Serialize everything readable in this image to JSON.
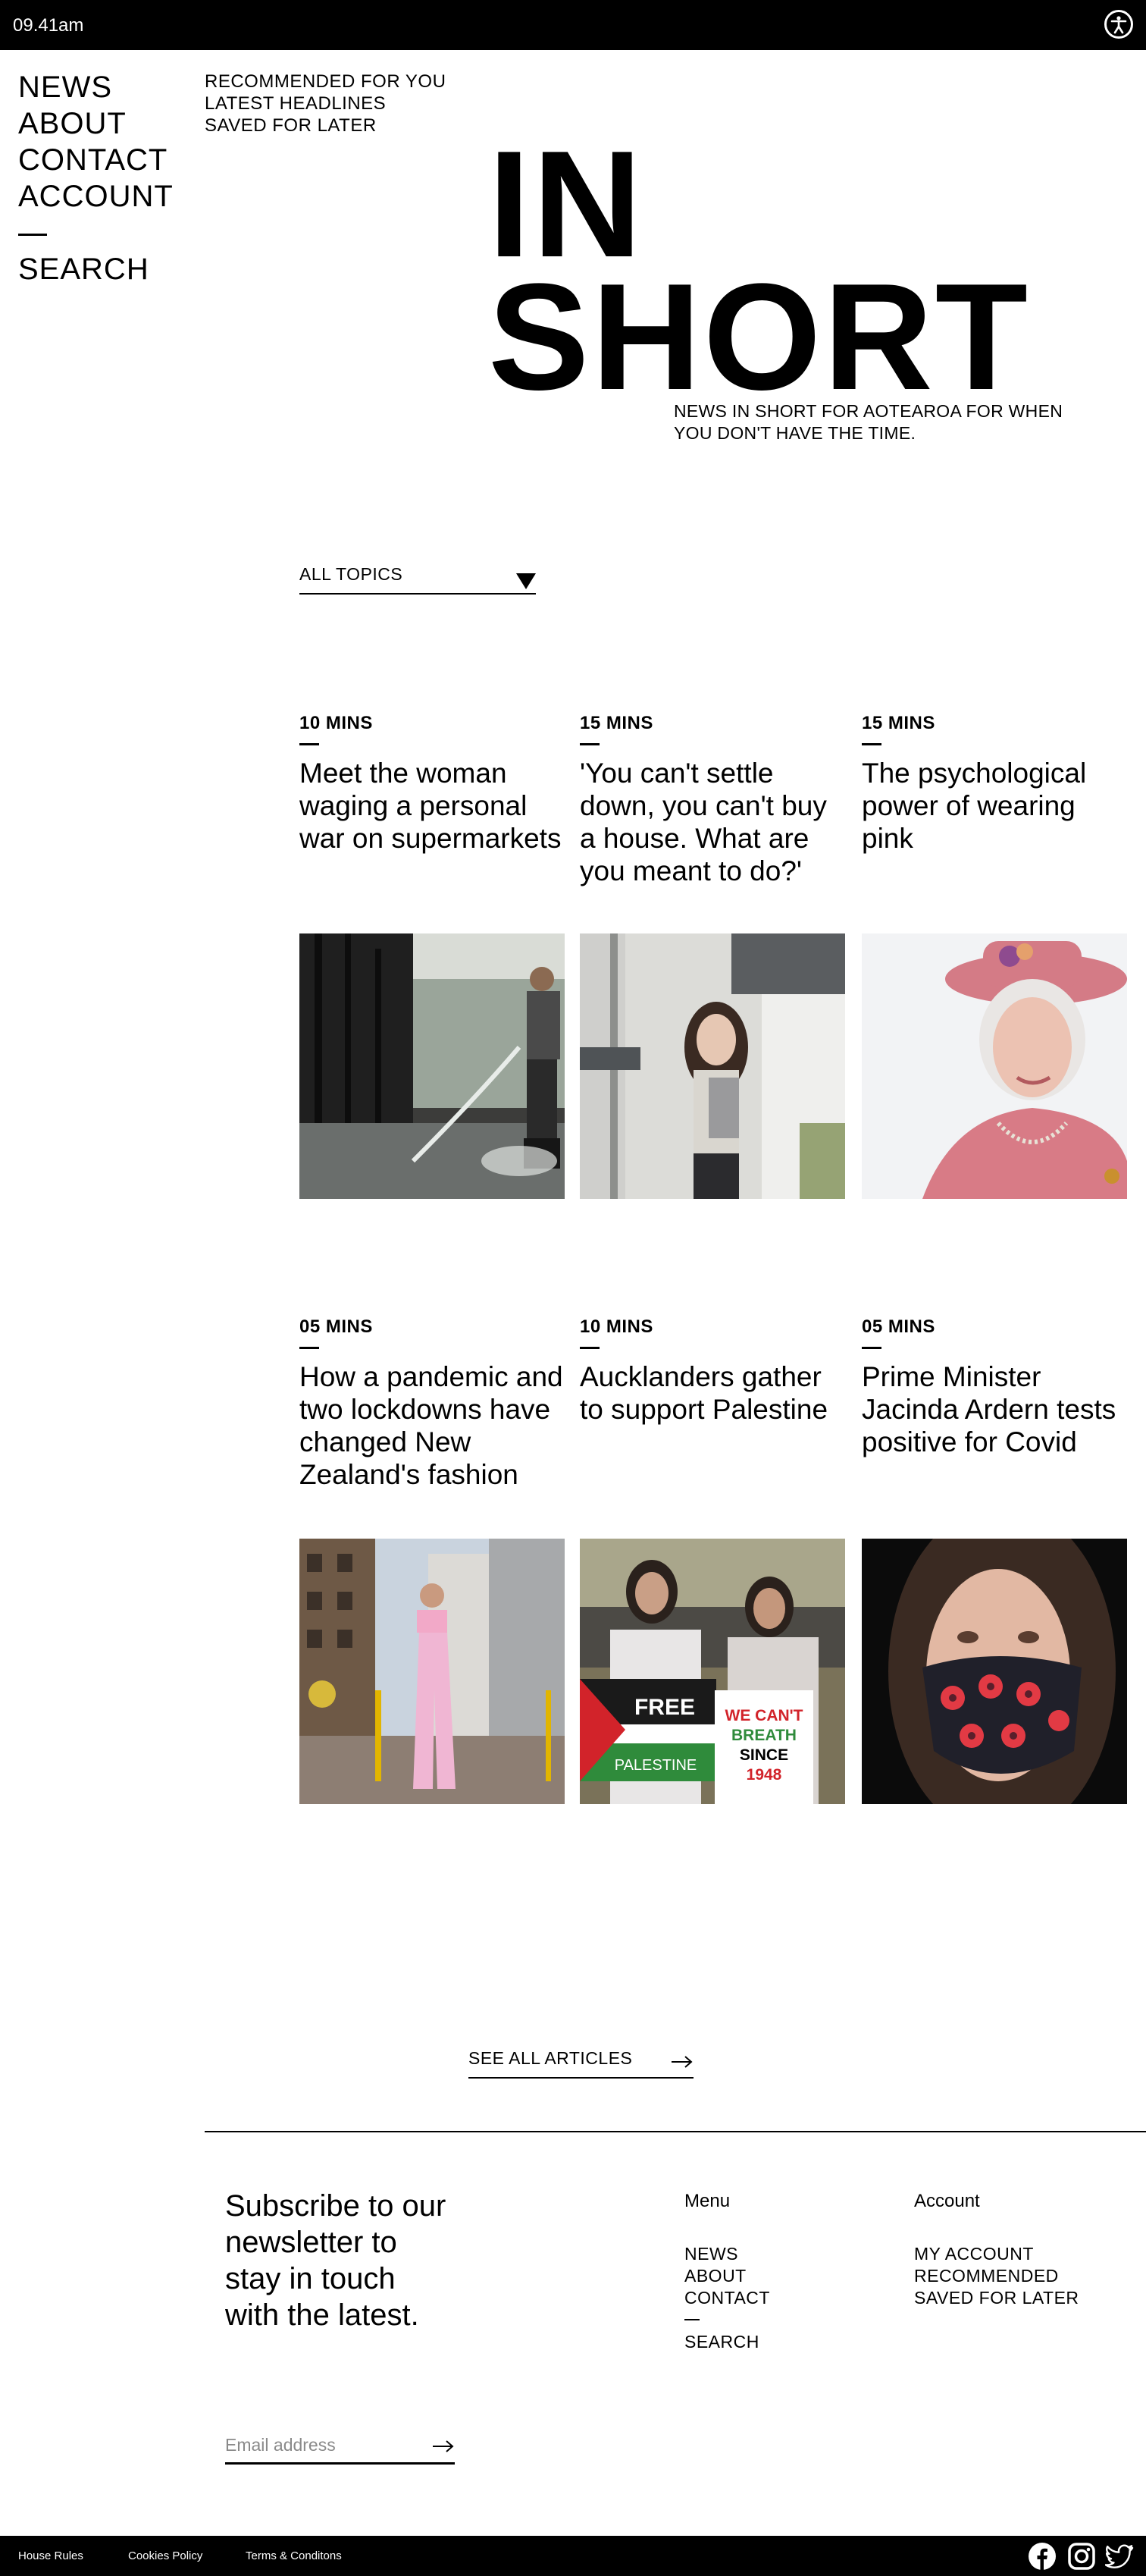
{
  "status_bar": {
    "time": "09.41am",
    "accessibility_icon": "accessibility-icon"
  },
  "main_nav": [
    {
      "label": "NEWS"
    },
    {
      "label": "ABOUT"
    },
    {
      "label": "CONTACT"
    },
    {
      "label": "ACCOUNT"
    },
    {
      "label": "SEARCH"
    }
  ],
  "sub_nav": [
    {
      "label": "RECOMMENDED FOR YOU"
    },
    {
      "label": "LATEST HEADLINES"
    },
    {
      "label": "SAVED FOR LATER"
    }
  ],
  "hero": {
    "line1": "IN",
    "line2": "SHORT",
    "tagline": "NEWS IN SHORT FOR AOTEAROA FOR WHEN YOU DON'T HAVE THE TIME."
  },
  "filter": {
    "label": "ALL TOPICS",
    "icon": "caret-down-icon"
  },
  "articles": [
    {
      "mins": "10 MINS",
      "title": "Meet the woman waging a personal war on supermarkets"
    },
    {
      "mins": "15 MINS",
      "title": "'You can't settle down, you can't buy a house. What are you meant to do?'"
    },
    {
      "mins": "15 MINS",
      "title": "The psychological power of wearing pink"
    },
    {
      "mins": "05 MINS",
      "title": "How a pandemic and two lockdowns have changed New Zealand's fashion"
    },
    {
      "mins": "10 MINS",
      "title": "Aucklanders gather to support Palestine"
    },
    {
      "mins": "05 MINS",
      "title": "Prime Minister Jacinda Ardern tests positive for Covid"
    }
  ],
  "protest_sign": {
    "left_top": "FREE",
    "left_bottom": "PALESTINE",
    "right_1": "WE CAN'T",
    "right_2": "BREATH",
    "right_3": "SINCE",
    "right_4": "1948"
  },
  "see_all": {
    "label": "SEE ALL ARTICLES"
  },
  "footer": {
    "newsletter": "Subscribe to our newsletter to stay in touch with the latest.",
    "email_placeholder": "Email address",
    "menu": {
      "heading": "Menu",
      "items": [
        {
          "label": "NEWS"
        },
        {
          "label": "ABOUT"
        },
        {
          "label": "CONTACT"
        },
        {
          "label": "SEARCH"
        }
      ]
    },
    "account": {
      "heading": "Account",
      "items": [
        {
          "label": "MY ACCOUNT"
        },
        {
          "label": "RECOMMENDED"
        },
        {
          "label": "SAVED FOR LATER"
        }
      ]
    }
  },
  "bottom_bar": {
    "links": [
      {
        "label": "House Rules"
      },
      {
        "label": "Cookies Policy"
      },
      {
        "label": "Terms & Conditons"
      }
    ],
    "social": [
      "facebook-icon",
      "instagram-icon",
      "twitter-icon"
    ]
  },
  "colors": {
    "bar": "#000000",
    "background": "#ffffff",
    "text": "#000000",
    "placeholder": "#8a8a8a"
  }
}
